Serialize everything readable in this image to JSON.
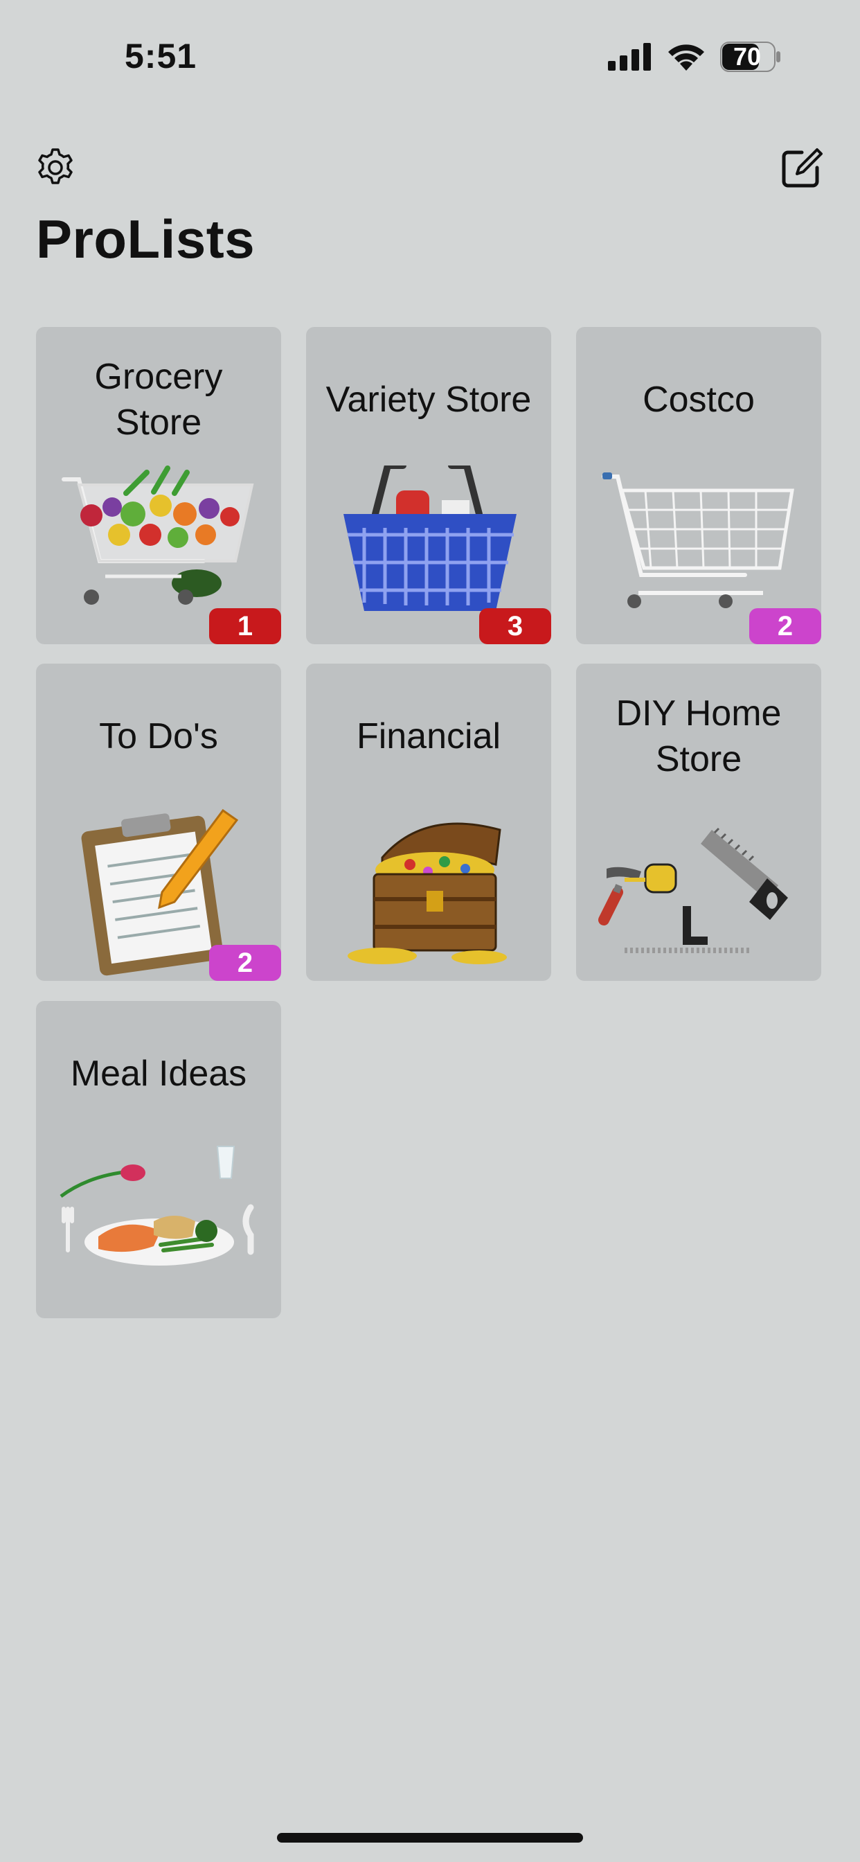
{
  "status": {
    "time": "5:51",
    "battery": "70"
  },
  "header": {
    "title": "ProLists",
    "settings_icon": "gear-icon",
    "compose_icon": "compose-icon"
  },
  "colors": {
    "background": "#d3d6d6",
    "tile": "#bec1c2",
    "badge_red": "#c8191c",
    "badge_purple": "#cc44cc"
  },
  "lists": [
    {
      "label": "Grocery Store",
      "icon": "grocery-cart-icon",
      "badge": "1",
      "badge_color": "red"
    },
    {
      "label": "Variety Store",
      "icon": "basket-icon",
      "badge": "3",
      "badge_color": "red"
    },
    {
      "label": "Costco",
      "icon": "cart-icon",
      "badge": "2",
      "badge_color": "purple"
    },
    {
      "label": "To Do's",
      "icon": "clipboard-icon",
      "badge": "2",
      "badge_color": "purple"
    },
    {
      "label": "Financial",
      "icon": "treasure-chest-icon"
    },
    {
      "label": "DIY Home Store",
      "icon": "tools-icon"
    },
    {
      "label": "Meal Ideas",
      "icon": "meal-plate-icon"
    }
  ]
}
